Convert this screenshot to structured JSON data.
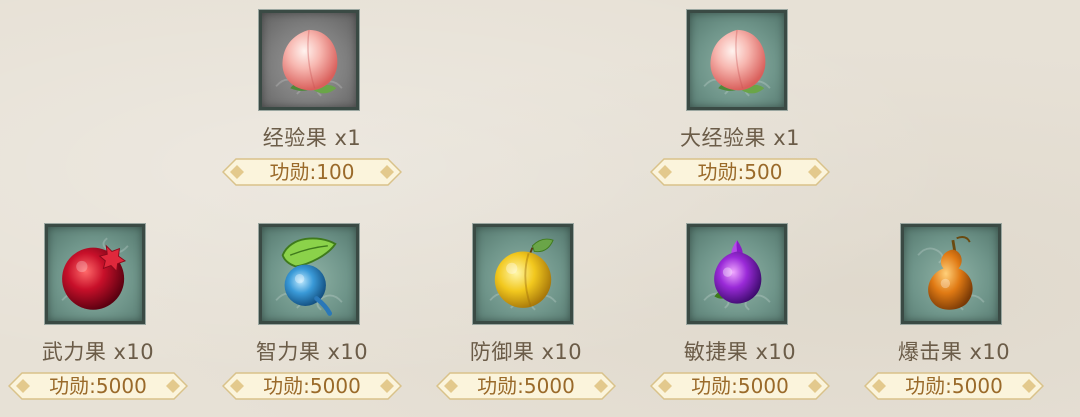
{
  "items": [
    {
      "name": "经验果 x1",
      "price": "功勋:100",
      "icon": "peach-icon",
      "frame": "grey"
    },
    {
      "name": "大经验果 x1",
      "price": "功勋:500",
      "icon": "peach-icon",
      "frame": "green"
    },
    {
      "name": "武力果 x10",
      "price": "功勋:5000",
      "icon": "red-pomegranate-icon",
      "frame": "green"
    },
    {
      "name": "智力果 x10",
      "price": "功勋:5000",
      "icon": "blue-fruit-icon",
      "frame": "green"
    },
    {
      "name": "防御果 x10",
      "price": "功勋:5000",
      "icon": "yellow-apricot-icon",
      "frame": "green"
    },
    {
      "name": "敏捷果 x10",
      "price": "功勋:5000",
      "icon": "purple-fruit-icon",
      "frame": "green"
    },
    {
      "name": "爆击果 x10",
      "price": "功勋:5000",
      "icon": "orange-gourd-icon",
      "frame": "green"
    }
  ],
  "colors": {
    "background": "#e7e1d6",
    "frame_green": "#6f958a",
    "frame_grey": "#7e7e7e",
    "name_text": "#6b5c48",
    "price_text": "#9a6a2a",
    "price_tag": "#fbf4dc"
  }
}
